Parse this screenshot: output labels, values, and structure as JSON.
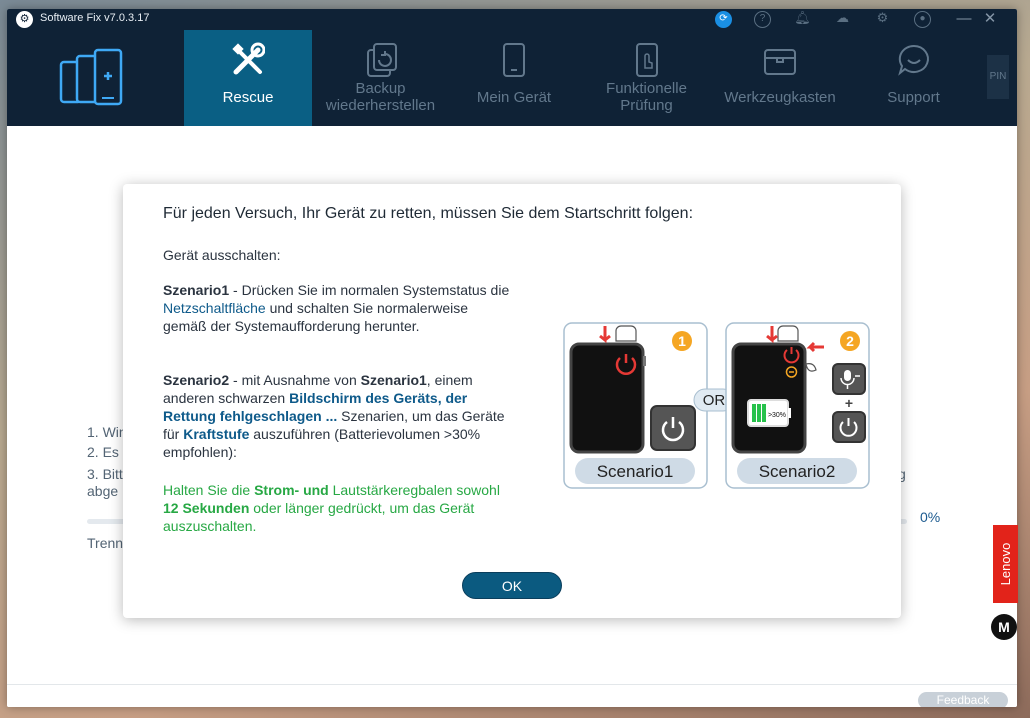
{
  "titlebar": {
    "app_title": "Software Fix v7.0.3.17",
    "icons": [
      "update-icon",
      "help-icon",
      "bell-icon",
      "cloud-download-icon",
      "settings-icon",
      "account-icon"
    ],
    "minimize_glyph": "—",
    "close_glyph": "✕"
  },
  "nav": {
    "tabs": [
      {
        "line1": "Rescue",
        "line2": "",
        "icon": "wrench-screwdriver-icon",
        "active": true
      },
      {
        "line1": "Backup",
        "line2": "wiederherstellen",
        "icon": "backup-icon",
        "active": false
      },
      {
        "line1": "Mein Gerät",
        "line2": "",
        "icon": "phone-icon",
        "active": false
      },
      {
        "line1": "Funktionelle",
        "line2": "Prüfung",
        "icon": "touch-test-icon",
        "active": false
      },
      {
        "line1": "Werkzeugkasten",
        "line2": "",
        "icon": "toolbox-icon",
        "active": false
      },
      {
        "line1": "Support",
        "line2": "",
        "icon": "chat-support-icon",
        "active": false
      }
    ],
    "pin_label": "PIN"
  },
  "background": {
    "steps": [
      "1. Win",
      "2. Es",
      "3. Bitt",
      "abge"
    ],
    "trailing_g": "g",
    "progress_value": 0,
    "progress_label": "0%",
    "disconnect_label": "Trenn"
  },
  "footer": {
    "feedback_label": "Feedback",
    "lenovo_label": "Lenovo",
    "moto_glyph": "M"
  },
  "dialog": {
    "title": "Für jeden Versuch, Ihr Gerät zu retten, müssen Sie dem Startschritt folgen:",
    "section_heading": "Gerät ausschalten:",
    "scenario1": {
      "name": "Szenario1",
      "text_a": " - Drücken Sie im normalen Systemstatus die ",
      "highlight": "Netzschaltfläche",
      "text_b": " und schalten Sie normalerweise gemäß der Systemaufforderung herunter."
    },
    "scenario2": {
      "name": "Szenario2",
      "text_a": " - mit Ausnahme von ",
      "ref": "Szenario1",
      "text_b": ", einem anderen schwarzen ",
      "highlight1": "Bildschirm des Geräts, der Rettung fehlgeschlagen ...",
      "text_c": " Szenarien, um das Geräte für ",
      "highlight2": "Kraftstufe",
      "text_d": " auszuführen (Batterievolumen >30% empfohlen):"
    },
    "instruction": {
      "text_a": "Halten Sie die ",
      "bold1": "Strom- und",
      "text_b": " Lautstärkeregbalen sowohl ",
      "bold2": "12 Sekunden",
      "text_c": " oder länger gedrückt, um das Gerät auszuschalten."
    },
    "illustration": {
      "panel1_label": "Scenario1",
      "panel1_number": "1",
      "panel2_label": "Scenario2",
      "panel2_number": "2",
      "or_label": "OR",
      "battery_label": ">30%",
      "plus_glyph": "+"
    },
    "ok_label": "OK"
  },
  "colors": {
    "navbar_bg": "#0f2236",
    "active_tab": "#0a5f84",
    "accent_blue": "#0e5a8a",
    "accent_green": "#27a844",
    "badge_orange": "#f5a623",
    "power_red": "#e53935"
  }
}
